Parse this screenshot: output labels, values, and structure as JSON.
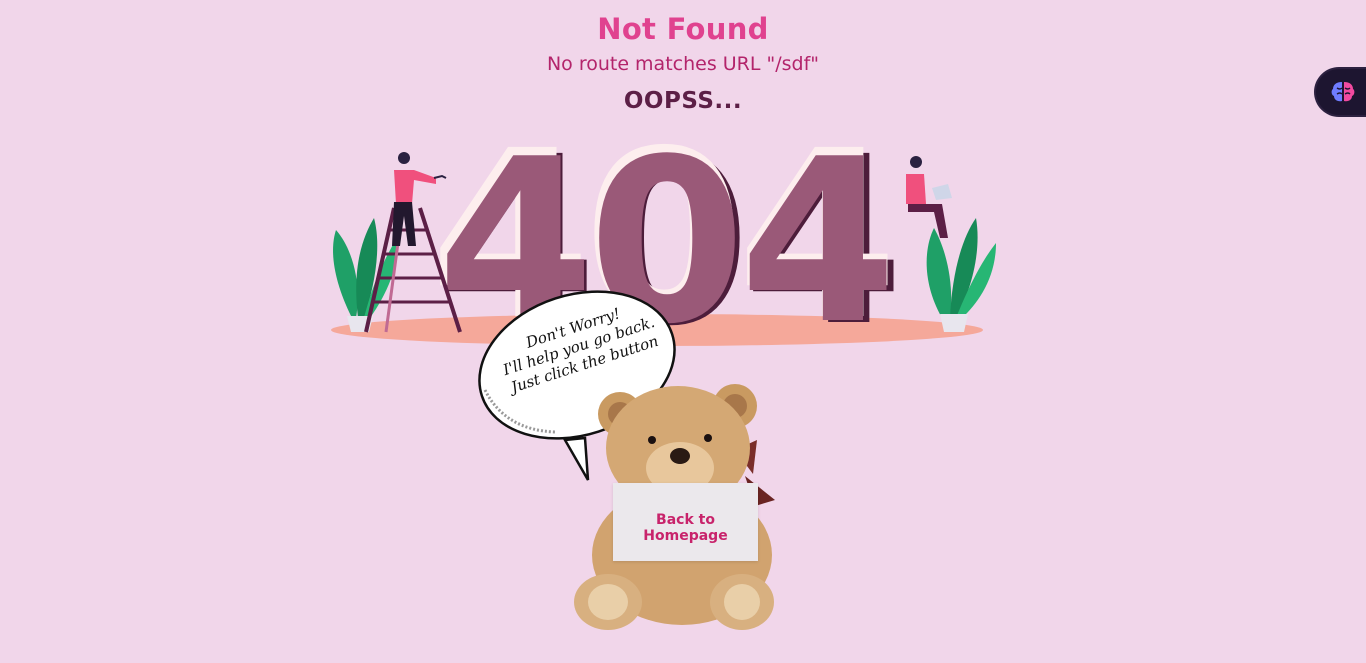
{
  "header": {
    "title": "Not Found",
    "subtitle": "No route matches URL \"/sdf\"",
    "oops": "OOPSS..."
  },
  "hero": {
    "big_number": "404"
  },
  "speech_bubble": {
    "line1": "Don't Worry!",
    "line2": "I'll help you go back.",
    "line3": "Just click the button"
  },
  "actions": {
    "home_label": "Back to Homepage"
  },
  "widget": {
    "icon": "brain-icon"
  },
  "colors": {
    "background": "#f1d6ea",
    "title": "#e0428f",
    "subtitle": "#b3246b",
    "oops": "#5c1f46",
    "digits": "#9a5978",
    "platform": "#f5a89a",
    "button_text": "#c8236b"
  }
}
